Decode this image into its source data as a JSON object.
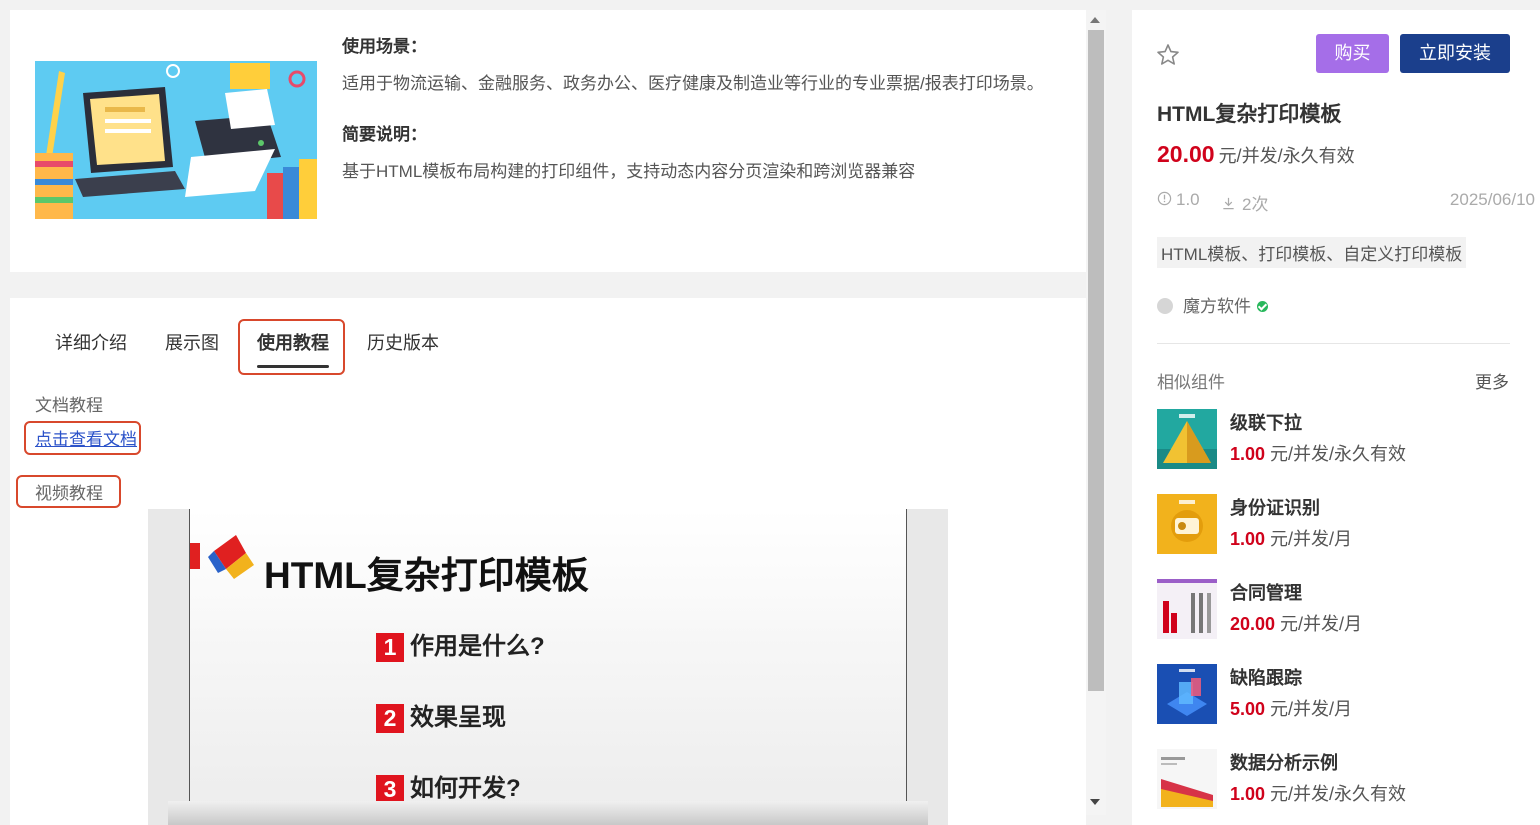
{
  "info": {
    "scenario_heading": "使用场景：",
    "scenario_text": "适用于物流运输、金融服务、政务办公、医疗健康及制造业等行业的专业票据/报表打印场景。",
    "summary_heading": "简要说明：",
    "summary_text": "基于HTML模板布局构建的打印组件，支持动态内容分页渲染和跨浏览器兼容"
  },
  "tabs": [
    "详细介绍",
    "展示图",
    "使用教程",
    "历史版本"
  ],
  "active_tab": "使用教程",
  "tutorial": {
    "doc_label": "文档教程",
    "doc_link": "点击查看文档",
    "video_label": "视频教程"
  },
  "video_slide": {
    "title": "HTML复杂打印模板",
    "items": [
      {
        "num": "1",
        "text": "作用是什么?"
      },
      {
        "num": "2",
        "text": "效果呈现"
      },
      {
        "num": "3",
        "text": "如何开发?"
      }
    ]
  },
  "product": {
    "buy_label": "购买",
    "install_label": "立即安装",
    "title": "HTML复杂打印模板",
    "price": "20.00",
    "price_unit": "元/并发/永久有效",
    "version": "1.0",
    "downloads": "2次",
    "date": "2025/06/10",
    "tags": "HTML模板、打印模板、自定义打印模板",
    "author": "魔方软件"
  },
  "similar": {
    "title": "相似组件",
    "more": "更多",
    "items": [
      {
        "name": "级联下拉",
        "price": "1.00",
        "unit": "元/并发/永久有效"
      },
      {
        "name": "身份证识别",
        "price": "1.00",
        "unit": "元/并发/月"
      },
      {
        "name": "合同管理",
        "price": "20.00",
        "unit": "元/并发/月"
      },
      {
        "name": "缺陷跟踪",
        "price": "5.00",
        "unit": "元/并发/月"
      },
      {
        "name": "数据分析示例",
        "price": "1.00",
        "unit": "元/并发/永久有效"
      }
    ]
  },
  "colors": {
    "accent_red": "#d0021b",
    "buy_purple": "#a56ee8",
    "install_navy": "#1b3f8c",
    "annotation_red": "#d8482c"
  }
}
